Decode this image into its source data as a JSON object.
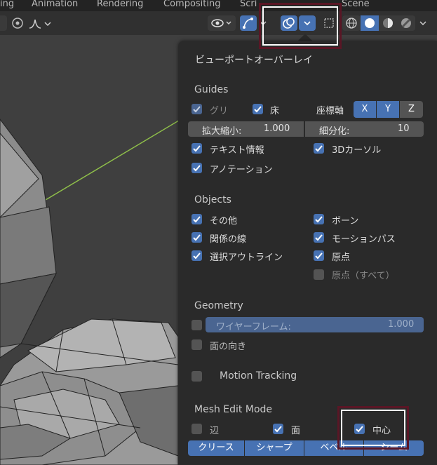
{
  "topbar": {
    "tabs": [
      "ing",
      "Animation",
      "Rendering",
      "Compositing",
      "Scri",
      "Scene"
    ]
  },
  "panel": {
    "title": "ビューポートオーバーレイ",
    "guides": {
      "heading": "Guides",
      "grid_label": "グリ",
      "floor_label": "床",
      "axes_label": "座標軸",
      "axes": [
        "X",
        "Y",
        "Z"
      ],
      "scale_label": "拡大縮小:",
      "scale_value": "1.000",
      "subdiv_label": "細分化:",
      "subdiv_value": "10",
      "text_info_label": "テキスト情報",
      "cursor3d_label": "3Dカーソル",
      "annotation_label": "アノテーション"
    },
    "objects": {
      "heading": "Objects",
      "extras_label": "その他",
      "bones_label": "ボーン",
      "relations_label": "関係の線",
      "motion_paths_label": "モーションパス",
      "outline_label": "選択アウトライン",
      "origins_label": "原点",
      "origins_all_label": "原点（すべて）"
    },
    "geometry": {
      "heading": "Geometry",
      "wireframe_label": "ワイヤーフレーム:",
      "wireframe_value": "1.000",
      "face_orientation_label": "面の向き"
    },
    "motion_tracking": {
      "label": "Motion Tracking"
    },
    "mesh_edit": {
      "heading": "Mesh Edit Mode",
      "edges_label": "辺",
      "faces_label": "面",
      "center_label": "中心",
      "buttons": [
        "クリース",
        "シャープ",
        "ベベル",
        "シーム"
      ]
    }
  },
  "colors": {
    "accent": "#4772b3",
    "panel_bg": "#2a2a2a",
    "highlight": "#5a1625"
  }
}
